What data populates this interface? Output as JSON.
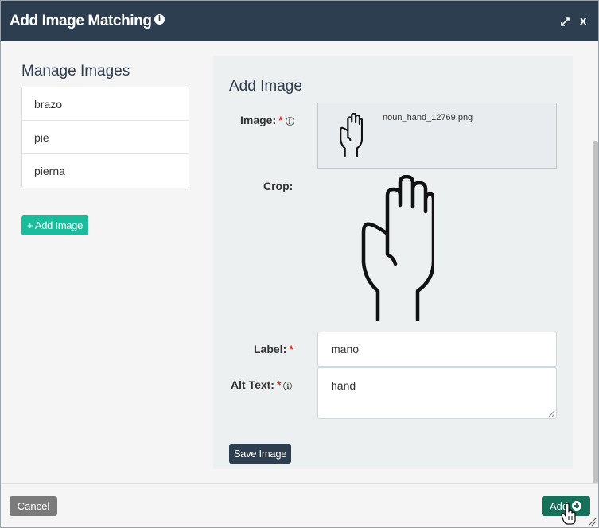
{
  "dialog": {
    "title": "Add Image Matching",
    "info_glyph": "i",
    "close_label": "x"
  },
  "manage": {
    "title": "Manage Images",
    "items": [
      {
        "label": "brazo"
      },
      {
        "label": "pie"
      },
      {
        "label": "pierna"
      }
    ],
    "add_button": "+ Add Image"
  },
  "form": {
    "title": "Add Image",
    "image_label": "Image:",
    "filename": "noun_hand_12769.png",
    "crop_label": "Crop:",
    "label_label": "Label:",
    "label_value": "mano",
    "alt_label": "Alt Text:",
    "alt_value": "hand",
    "required_mark": "*",
    "info_glyph": "i",
    "save_button": "Save Image"
  },
  "footer": {
    "cancel_button": "Cancel",
    "add_button": "Add"
  },
  "colors": {
    "titlebar": "#2c3e50",
    "accent_teal": "#1abc9c",
    "add_green": "#16705a",
    "required_red": "#c0392b"
  }
}
